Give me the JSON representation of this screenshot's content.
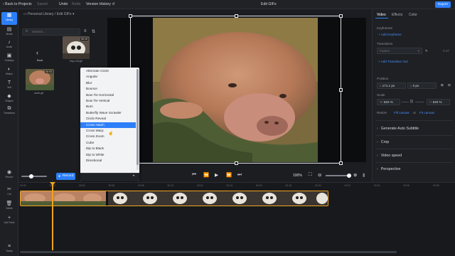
{
  "topbar": {
    "back_label": "Back to Projects",
    "saved_label": "Saved",
    "undo_label": "Undo",
    "redo_label": "Redo",
    "version_history_label": "Version History",
    "title": "Edit GIFs",
    "export_label": "Export"
  },
  "rail": [
    {
      "label": "Library",
      "icon": "library-icon"
    },
    {
      "label": "Media",
      "icon": "media-icon"
    },
    {
      "label": "Audio",
      "icon": "music-icon"
    },
    {
      "label": "Overlays",
      "icon": "overlays-icon"
    },
    {
      "label": "Motion",
      "icon": "motion-icon"
    },
    {
      "label": "Text",
      "icon": "text-icon"
    },
    {
      "label": "Shapes",
      "icon": "shapes-icon"
    },
    {
      "label": "Transitions",
      "icon": "transitions-icon"
    }
  ],
  "rail_bottom": [
    {
      "label": "Record",
      "icon": "record-icon"
    },
    {
      "label": "Cut",
      "icon": "scissors-icon"
    },
    {
      "label": "Delete",
      "icon": "trash-icon"
    },
    {
      "label": "Add Track",
      "icon": "add-track-icon"
    },
    {
      "label": "Tracks",
      "icon": "tracks-icon"
    }
  ],
  "library": {
    "breadcrumb_root": "Personal Library",
    "breadcrumb_current": "Edit GIFs",
    "search_placeholder": "Search...",
    "back_label": "Back",
    "items": [
      {
        "name": "imp-roll.gif",
        "duration": "00:19"
      },
      {
        "name": "sloth.gif",
        "duration": "00:03"
      }
    ]
  },
  "transitions_dropdown": {
    "options": [
      "Alternate Circle",
      "Angular",
      "Blur",
      "Bounce",
      "Bow Tie Horizontal",
      "Bow Tie Vertical",
      "Burn",
      "Butterfly Wave Scrawler",
      "Circle Reveal",
      "Cross Hatch",
      "Cross Warp",
      "Cross Zoom",
      "Cube",
      "Dip to Black",
      "Dip to White",
      "Directional"
    ],
    "selected": "Cross Hatch"
  },
  "controls": {
    "record_label": "Record",
    "zoom": "100%"
  },
  "right_panel": {
    "tabs": [
      "Video",
      "Effects",
      "Color"
    ],
    "active_tab": "Video",
    "keyframes_label": "Keyframes",
    "add_keyframe_label": "+ Add Keyframe",
    "transitions_label": "Transitions",
    "transition_value": "Fadein",
    "transition_duration": "0.37",
    "add_transition_out_label": "+ Add Transition Out",
    "position_label": "Position",
    "position_x_prefix": "x",
    "position_x": "171.1 px",
    "position_y_prefix": "y",
    "position_y": "0 px",
    "scale_label": "Scale",
    "scale_w_prefix": "W",
    "scale_w": "540 %",
    "scale_h_prefix": "H",
    "scale_h": "540 %",
    "resize_label": "Resize",
    "fill_canvas_label": "Fill canvas",
    "or_label": "or",
    "fit_canvas_label": "Fit canvas",
    "sections": [
      "Generate Auto Subtitle",
      "Crop",
      "Video speed",
      "Perspective"
    ]
  },
  "timeline": {
    "ticks": [
      "00:00",
      "00:02",
      "00:04",
      "00:06",
      "00:08",
      "00:10",
      "00:12",
      "00:14",
      "00:16",
      "00:18",
      "00:20",
      "00:22",
      "00:24",
      "00:26",
      "00:28"
    ]
  },
  "colors": {
    "accent": "#2d7ff9",
    "track_border": "#f0a31f",
    "background": "#1b1d21"
  }
}
